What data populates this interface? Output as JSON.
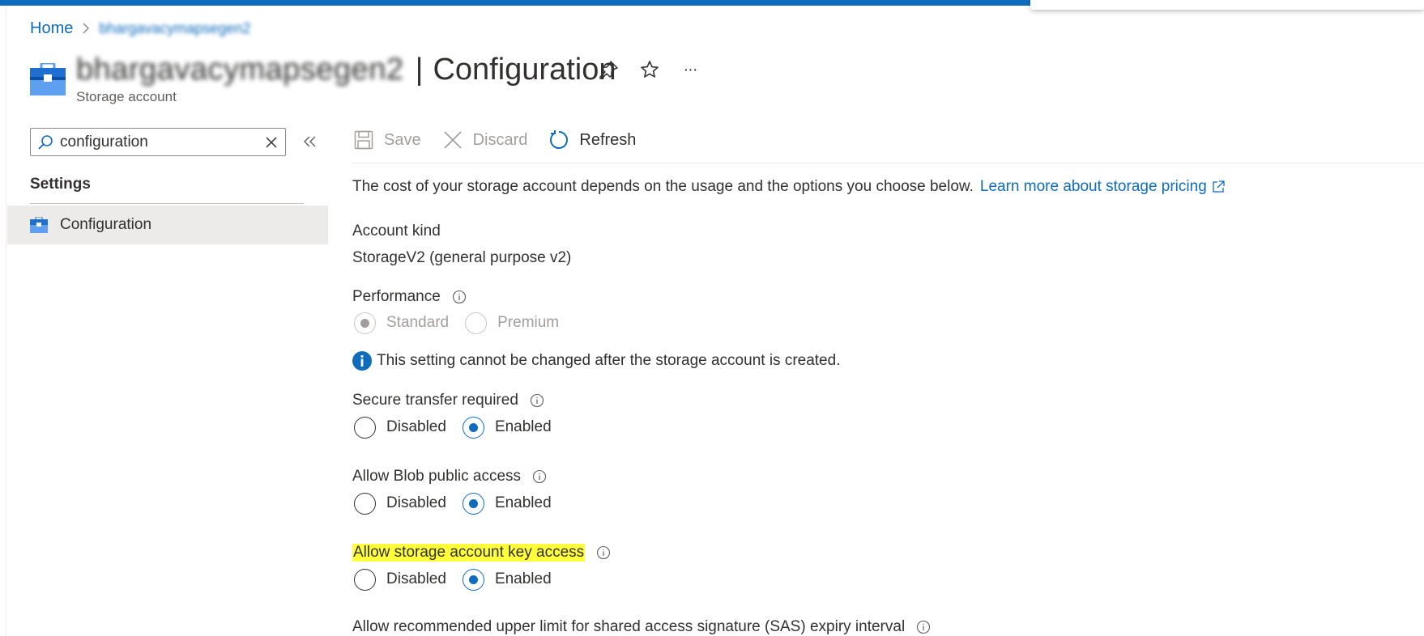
{
  "breadcrumb": {
    "home": "Home",
    "resource": "bhargavacymapsegen2"
  },
  "header": {
    "resource_name": "bhargavacymapsegen2",
    "separator": "|",
    "page": "Configuration",
    "subtitle": "Storage account",
    "actions": [
      "pin-icon",
      "star-icon",
      "more-icon"
    ],
    "more_glyph": "···"
  },
  "sidebar": {
    "search": {
      "value": "configuration"
    },
    "group_heading": "Settings",
    "items": [
      {
        "label": "Configuration",
        "icon": "storage-briefcase-icon",
        "selected": true
      }
    ]
  },
  "toolbar": {
    "save_label": "Save",
    "discard_label": "Discard",
    "refresh_label": "Refresh"
  },
  "content": {
    "intro_text": "The cost of your storage account depends on the usage and the options you choose below.",
    "intro_link": "Learn more about storage pricing",
    "account_kind": {
      "label": "Account kind",
      "value": "StorageV2 (general purpose v2)"
    },
    "performance": {
      "label": "Performance",
      "options": [
        "Standard",
        "Premium"
      ],
      "selected": "Standard",
      "disabled": true
    },
    "notice": "This setting cannot be changed after the storage account is created.",
    "secure_transfer": {
      "label": "Secure transfer required",
      "options": [
        "Disabled",
        "Enabled"
      ],
      "selected": "Enabled"
    },
    "blob_public_access": {
      "label": "Allow Blob public access",
      "options": [
        "Disabled",
        "Enabled"
      ],
      "selected": "Enabled"
    },
    "key_access": {
      "label": "Allow storage account key access",
      "options": [
        "Disabled",
        "Enabled"
      ],
      "selected": "Enabled",
      "highlighted": true
    },
    "sas_limit": {
      "label": "Allow recommended upper limit for shared access signature (SAS) expiry interval"
    }
  },
  "colors": {
    "accent": "#0f6cbd",
    "highlight": "#ffff3b",
    "selected_nav_bg": "#edebe9",
    "text": "#323130",
    "disabled_text": "#a19f9d"
  }
}
